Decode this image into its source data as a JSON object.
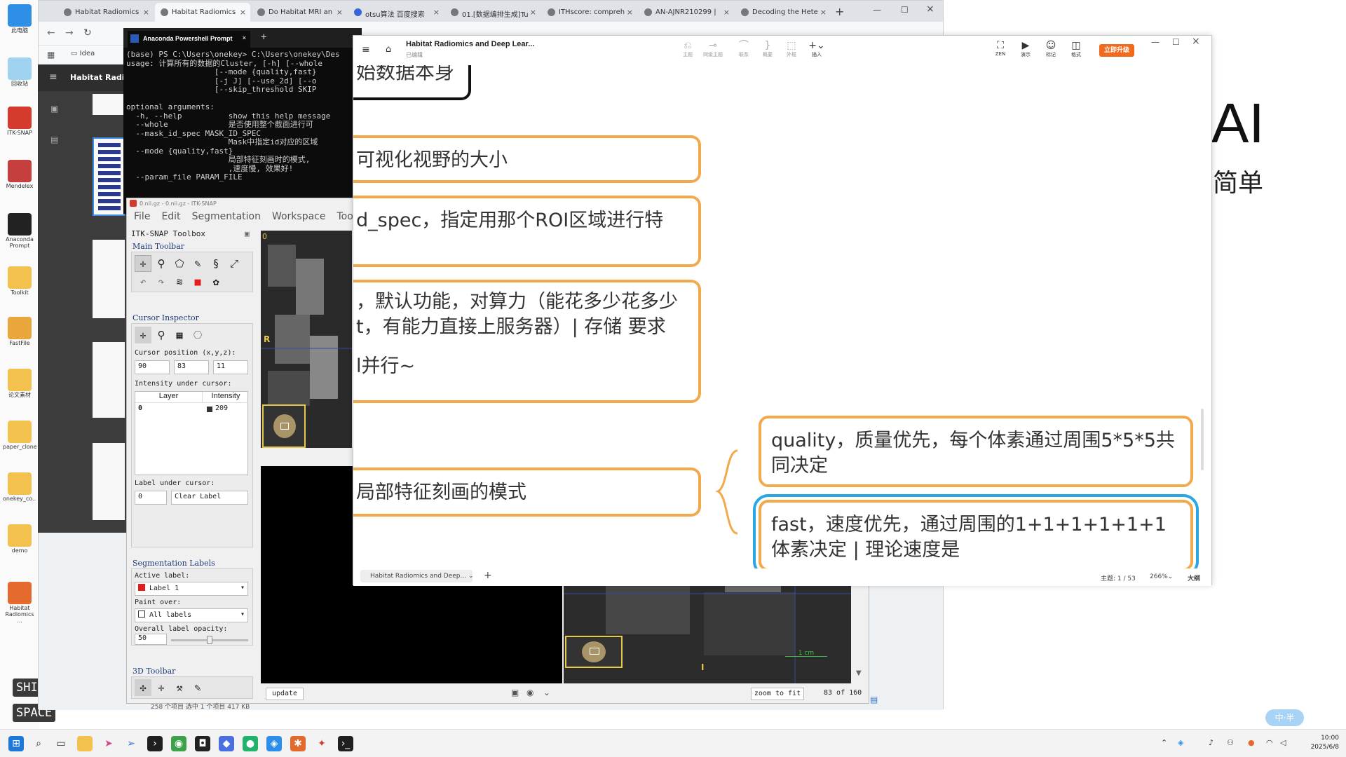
{
  "desktop": {
    "icons": [
      "此电脑",
      "回收站",
      "ITK-SNAP",
      "Mendelex",
      "Anaconda Prompt",
      "Toolkit",
      "FastFile",
      "论文素材",
      "paper_clone",
      "onekey_co...",
      "demo",
      "Habitat Radiomics ..."
    ],
    "key_hints": [
      "SHI",
      "SPACE"
    ]
  },
  "browser": {
    "tabs": [
      {
        "label": "Habitat Radiomics"
      },
      {
        "label": "Habitat Radiomics"
      },
      {
        "label": "Do Habitat MRI an"
      },
      {
        "label": "otsu算法 百度搜索"
      },
      {
        "label": "01.[数据编排生成]Tu"
      },
      {
        "label": "ITHscore: compreh"
      },
      {
        "label": "AN-AJNR210299 |"
      },
      {
        "label": "Decoding the Hete"
      }
    ],
    "bookmarks": [
      "Idea"
    ],
    "doc_title": "Habitat Radiom"
  },
  "terminal": {
    "tab_title": "Anaconda Powershell Prompt",
    "lines": [
      "(base) PS C:\\Users\\onekey> C:\\Users\\onekey\\Des",
      "usage: 计算所有的数据的Cluster, [-h] [--whole",
      "                   [--mode {quality,fast}",
      "                   [-j J] [--use_2d] [--o",
      "                   [--skip_threshold SKIP",
      "",
      "optional arguments:",
      "  -h, --help          show this help message",
      "  --whole             是否使用整个截面进行可",
      "  --mask_id_spec MASK_ID_SPEC",
      "                      Mask中指定id对应的区域",
      "  --mode {quality,fast}",
      "                      局部特征刻画时的模式,",
      "                      ,速度慢, 效果好!",
      "  --param_file PARAM_FILE"
    ]
  },
  "itk": {
    "window_title": "0.nii.gz - 0.nii.gz - ITK-SNAP",
    "menu": [
      "File",
      "Edit",
      "Segmentation",
      "Workspace",
      "Tools"
    ],
    "toolbox_title": "ITK-SNAP Toolbox",
    "main_toolbar": "Main Toolbar",
    "cursor_inspector": "Cursor Inspector",
    "cursor_position_label": "Cursor position (x,y,z):",
    "cursor_x": "90",
    "cursor_y": "83",
    "cursor_z": "11",
    "intensity_label": "Intensity under cursor:",
    "col_layer": "Layer",
    "col_intensity": "Intensity",
    "layer_value": "0",
    "intensity_value": "209",
    "label_under_cursor": "Label under cursor:",
    "label_id": "0",
    "label_name": "Clear Label",
    "seg_labels": "Segmentation Labels",
    "active_label_caption": "Active label:",
    "active_label": "Label 1",
    "paint_over_caption": "Paint over:",
    "paint_over": "All labels",
    "opacity_caption": "Overall label opacity:",
    "opacity_value": "50",
    "opacity": 0.5,
    "toolbar_3d": "3D Toolbar",
    "update_btn": "update",
    "zoom_to_fit": "zoom to fit",
    "slice_counter": "83 of 160",
    "scale_label": "1 cm",
    "viewer_marker_r": "R",
    "viewer_marker_i": "I",
    "viewer_marker_0": "0",
    "status_left": "258 个项目    选中 1 个项目 417 KB",
    "colors": {
      "label1": "#e31b1b",
      "section": "#1c3b7a"
    }
  },
  "mindmap": {
    "title": "Habitat Radiomics and Deep Lear...",
    "subtitle": "已编辑",
    "toolbar": [
      "主题",
      "同级主题",
      "联系",
      "概要",
      "外框",
      "插入"
    ],
    "right_toolbar": [
      "ZEN",
      "演示",
      "标记",
      "格式"
    ],
    "upgrade": "立即升级",
    "nodes": {
      "n0": "始数据本身",
      "n1": "可视化视野的大小",
      "n2": "d_spec，指定用那个ROI区域进行特",
      "n3a": "，默认功能，对算力（能花多少花多少",
      "n3b": "t，有能力直接上服务器）| 存储 要求",
      "n3c": "l并行~",
      "n4": "局部特征刻画的模式",
      "n5": "quality，质量优先，每个体素通过周围5*5*5共同决定",
      "n6": "fast，速度优先，通过周围的1+1+1+1+1+1体素决定 | 理论速度是"
    },
    "doc_tab": "Habitat Radiomics and Deep...",
    "status_topic": "主题: 1 / 53",
    "zoom": "266%",
    "outline": "大纲",
    "colors": {
      "node_border": "#f2a94b",
      "selected": "#2aa7e0",
      "upgrade": "#f26b1d"
    }
  },
  "background": {
    "ai_text": "AI",
    "han_text": "简单"
  },
  "ime": "中·半",
  "taskbar": {
    "time": "10:00",
    "date": "2025/6/8"
  }
}
